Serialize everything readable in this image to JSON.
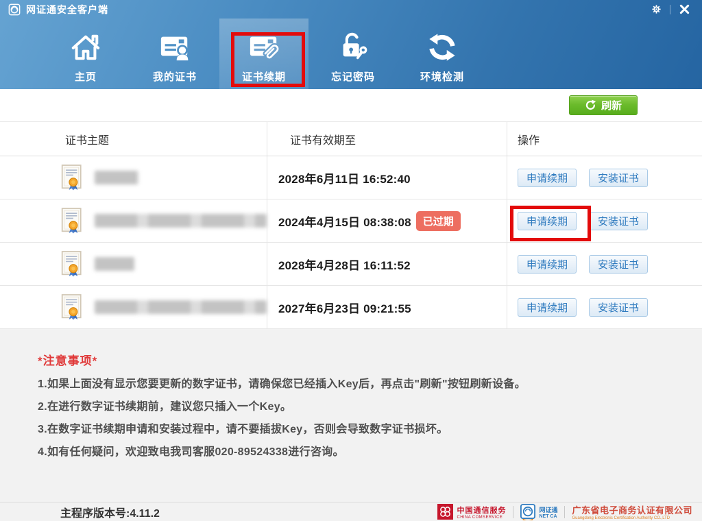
{
  "titlebar": {
    "title": "网证通安全客户端"
  },
  "nav": {
    "tabs": [
      {
        "label": "主页",
        "active": false
      },
      {
        "label": "我的证书",
        "active": false
      },
      {
        "label": "证书续期",
        "active": true
      },
      {
        "label": "忘记密码",
        "active": false
      },
      {
        "label": "环境检测",
        "active": false
      }
    ]
  },
  "toolbar": {
    "refresh_label": "刷新"
  },
  "table": {
    "headers": [
      "证书主题",
      "证书有效期至",
      "操作"
    ],
    "action_labels": {
      "renew": "申请续期",
      "install": "安装证书"
    },
    "rows": [
      {
        "expiry": "2028年6月11日 16:52:40",
        "expired": false
      },
      {
        "expiry": "2024年4月15日 08:38:08",
        "expired": true,
        "expired_label": "已过期"
      },
      {
        "expiry": "2028年4月28日 16:11:52",
        "expired": false
      },
      {
        "expiry": "2027年6月23日 09:21:55",
        "expired": false
      }
    ]
  },
  "notes": {
    "title": "*注意事项*",
    "items": [
      "1.如果上面没有显示您要更新的数字证书，请确保您已经插入Key后，再点击\"刷新\"按钮刷新设备。",
      "2.在进行数字证书续期前，建议您只插入一个Key。",
      "3.在数字证书续期申请和安装过程中，请不要插拔Key，否则会导致数字证书损坏。",
      "4.如有任何疑问，欢迎致电我司客服020-89524338进行咨询。"
    ]
  },
  "footer": {
    "version": "主程序版本号:4.11.2",
    "logos": {
      "comservice": {
        "cn": "中国通信服务",
        "en": "CHINA COMSERVICE"
      },
      "netca": {
        "cn": "网证通",
        "en": "NET CA"
      },
      "gdca": {
        "cn": "广东省电子商务认证有限公司",
        "en": "Guangdong Electronic Certification Authority CO.,LTD"
      }
    }
  },
  "colors": {
    "header_blue": "#3b7fb8",
    "refresh_green": "#63b32a",
    "expired_red": "#ed6e60",
    "annotation_red": "#e30b0b",
    "action_button_blue": "#2f7bbf"
  }
}
